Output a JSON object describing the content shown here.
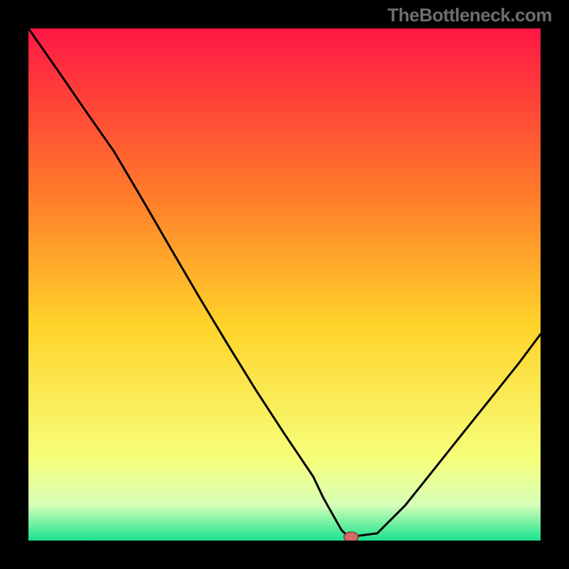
{
  "watermark": "TheBottleneck.com",
  "colors": {
    "top": "#ff1744",
    "mid_upper": "#ff7a2a",
    "mid": "#ffd32a",
    "mid_lower": "#f6ff7a",
    "band": "#d7ffb8",
    "bottom": "#19e38f",
    "line": "#000000",
    "marker_fill": "#d36a67",
    "marker_stroke": "#8b3a3a"
  },
  "chart_data": {
    "type": "line",
    "title": "",
    "xlabel": "",
    "ylabel": "",
    "xlim": [
      0,
      100
    ],
    "ylim": [
      0,
      100
    ],
    "series": [
      {
        "name": "curve",
        "x": [
          0.0,
          5.6,
          11.1,
          16.7,
          22.2,
          27.8,
          33.3,
          38.9,
          44.4,
          50.0,
          55.6,
          57.6,
          61.1,
          62.5,
          68.1,
          73.6,
          79.2,
          84.7,
          90.3,
          95.8,
          100.0
        ],
        "y": [
          100.0,
          92.0,
          84.0,
          76.0,
          66.7,
          57.0,
          47.6,
          38.3,
          29.4,
          20.8,
          12.5,
          8.3,
          2.1,
          0.7,
          1.4,
          6.9,
          13.9,
          20.8,
          27.8,
          34.7,
          40.3
        ]
      }
    ],
    "marker": {
      "x": 63.0,
      "y": 0.7
    }
  }
}
